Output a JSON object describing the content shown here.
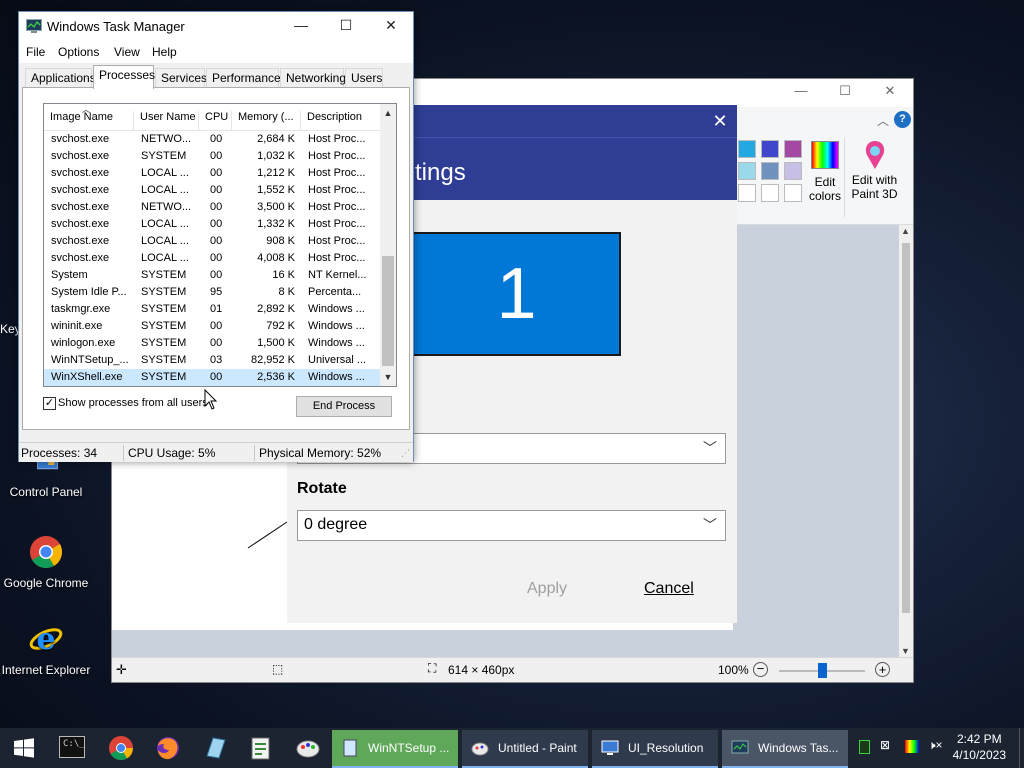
{
  "desktop": {
    "partial_label": "Key",
    "icons": [
      {
        "label": "Control Panel"
      },
      {
        "label": "Google Chrome"
      },
      {
        "label": "Internet Explorer"
      }
    ]
  },
  "paint": {
    "ribbon": {
      "edit_colors_line1": "Edit",
      "edit_colors_line2": "colors",
      "edit_3d_line1": "Edit with",
      "edit_3d_line2": "Paint 3D"
    },
    "status": {
      "size": "614 × 460px",
      "zoom": "100%",
      "zoom_fraction": 0.5
    }
  },
  "display_settings": {
    "title_partial": "tings",
    "monitor_number": "1",
    "rotate_label": "Rotate",
    "rotate_value": "0 degree",
    "apply_label": "Apply",
    "cancel_label": "Cancel"
  },
  "task_manager": {
    "title": "Windows Task Manager",
    "menu": [
      "File",
      "Options",
      "View",
      "Help"
    ],
    "tabs": [
      "Applications",
      "Processes",
      "Services",
      "Performance",
      "Networking",
      "Users"
    ],
    "active_tab": "Processes",
    "columns": [
      "Image Name",
      "User Name",
      "CPU",
      "Memory (...",
      "Description"
    ],
    "rows": [
      [
        "svchost.exe",
        "NETWO...",
        "00",
        "2,684 K",
        "Host Proc..."
      ],
      [
        "svchost.exe",
        "SYSTEM",
        "00",
        "1,032 K",
        "Host Proc..."
      ],
      [
        "svchost.exe",
        "LOCAL ...",
        "00",
        "1,212 K",
        "Host Proc..."
      ],
      [
        "svchost.exe",
        "LOCAL ...",
        "00",
        "1,552 K",
        "Host Proc..."
      ],
      [
        "svchost.exe",
        "NETWO...",
        "00",
        "3,500 K",
        "Host Proc..."
      ],
      [
        "svchost.exe",
        "LOCAL ...",
        "00",
        "1,332 K",
        "Host Proc..."
      ],
      [
        "svchost.exe",
        "LOCAL ...",
        "00",
        "908 K",
        "Host Proc..."
      ],
      [
        "svchost.exe",
        "LOCAL ...",
        "00",
        "4,008 K",
        "Host Proc..."
      ],
      [
        "System",
        "SYSTEM",
        "00",
        "16 K",
        "NT Kernel..."
      ],
      [
        "System Idle P...",
        "SYSTEM",
        "95",
        "8 K",
        "Percenta..."
      ],
      [
        "taskmgr.exe",
        "SYSTEM",
        "01",
        "2,892 K",
        "Windows ..."
      ],
      [
        "wininit.exe",
        "SYSTEM",
        "00",
        "792 K",
        "Windows ..."
      ],
      [
        "winlogon.exe",
        "SYSTEM",
        "00",
        "1,500 K",
        "Windows ..."
      ],
      [
        "WinNTSetup_...",
        "SYSTEM",
        "03",
        "82,952 K",
        "Universal ..."
      ],
      [
        "WinXShell.exe",
        "SYSTEM",
        "00",
        "2,536 K",
        "Windows ..."
      ]
    ],
    "selected_row": 14,
    "show_all_users_label": "Show processes from all users",
    "show_all_users_checked": "✓",
    "end_process_label": "End Process",
    "status": {
      "processes": "Processes: 34",
      "cpu": "CPU Usage: 5%",
      "memory": "Physical Memory: 52%"
    }
  },
  "taskbar": {
    "buttons": [
      {
        "label": "WinNTSetup ..."
      },
      {
        "label": "Untitled - Paint"
      },
      {
        "label": "UI_Resolution"
      },
      {
        "label": "Windows Tas..."
      }
    ],
    "clock_time": "2:42 PM",
    "clock_date": "4/10/2023"
  }
}
